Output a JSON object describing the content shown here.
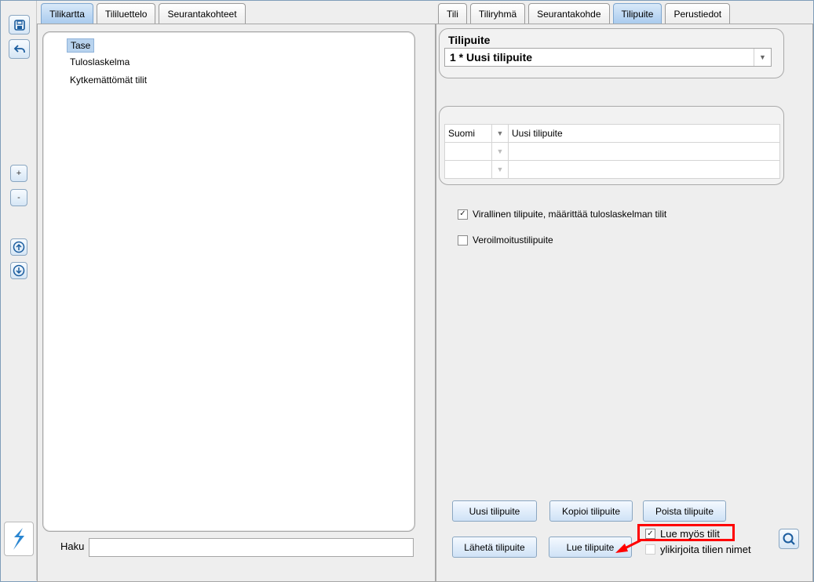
{
  "left_tabs": [
    {
      "label": "Tilikartta",
      "active": true
    },
    {
      "label": "Tililuettelo",
      "active": false
    },
    {
      "label": "Seurantakohteet",
      "active": false
    }
  ],
  "right_tabs": [
    {
      "label": "Tili",
      "active": false
    },
    {
      "label": "Tiliryhmä",
      "active": false
    },
    {
      "label": "Seurantakohde",
      "active": false
    },
    {
      "label": "Tilipuite",
      "active": true
    },
    {
      "label": "Perustiedot",
      "active": false
    }
  ],
  "tree": {
    "items": [
      {
        "label": "Tase",
        "selected": true
      },
      {
        "label": "Tuloslaskelma",
        "selected": false
      },
      {
        "label": "Kytkemättömät tilit",
        "selected": false
      }
    ]
  },
  "search": {
    "label": "Haku",
    "value": ""
  },
  "toolbar": {
    "plus": "+",
    "minus": "-"
  },
  "tilipuite": {
    "title": "Tilipuite",
    "selected": "1 * Uusi tilipuite"
  },
  "names_grid": [
    {
      "lang": "Suomi",
      "name": "Uusi tilipuite"
    },
    {
      "lang": "",
      "name": ""
    },
    {
      "lang": "",
      "name": ""
    }
  ],
  "checkboxes": {
    "official": {
      "label": "Virallinen tilipuite, määrittää tuloslaskelman tilit",
      "checked": true
    },
    "tax": {
      "label": "Veroilmoitustilipuite",
      "checked": false
    },
    "read_accounts": {
      "label": "Lue myös tilit",
      "checked": true
    },
    "overwrite_names": {
      "label": "ylikirjoita tilien nimet",
      "checked": false
    }
  },
  "buttons": {
    "new": "Uusi tilipuite",
    "copy": "Kopioi tilipuite",
    "delete": "Poista tilipuite",
    "send": "Lähetä tilipuite",
    "read": "Lue tilipuite"
  },
  "colors": {
    "accent": "#b8d3ee",
    "highlight": "#ff0000",
    "button_border": "#8aa6c1"
  },
  "icons": {
    "save": "save-icon",
    "undo": "undo-icon",
    "move_up": "arrow-up-circle-icon",
    "move_down": "arrow-down-circle-icon",
    "logo": "app-logo-icon",
    "search": "magnifier-icon",
    "dropdown": "chevron-down-icon"
  }
}
